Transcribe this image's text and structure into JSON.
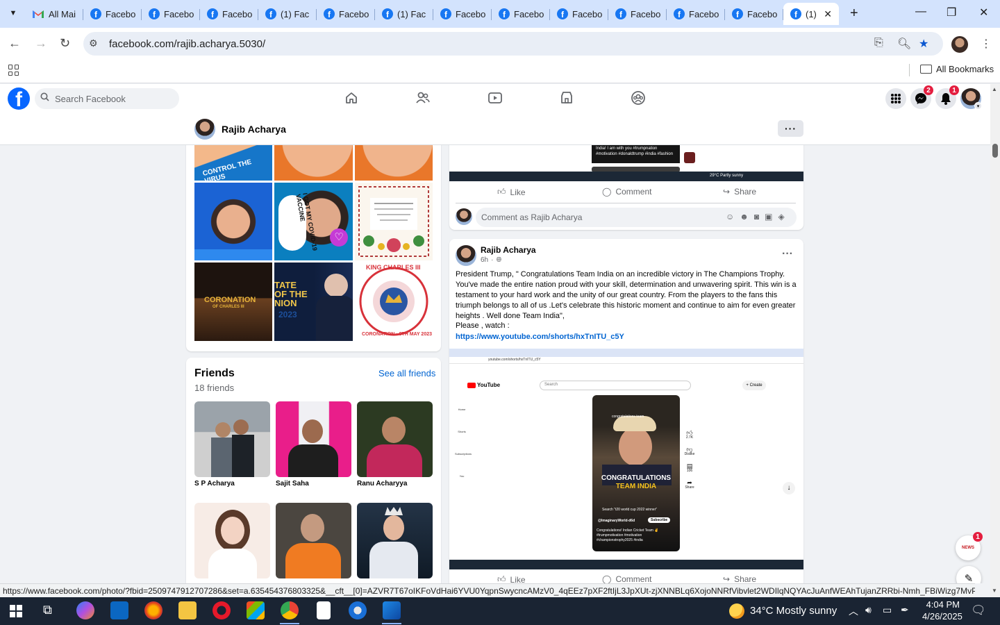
{
  "browser": {
    "tabs": [
      {
        "label": "All Mai",
        "favicon": "gmail-icon"
      },
      {
        "label": "Facebo",
        "favicon": "facebook-icon"
      },
      {
        "label": "Facebo",
        "favicon": "facebook-icon"
      },
      {
        "label": "Facebo",
        "favicon": "facebook-icon"
      },
      {
        "label": "(1) Fac",
        "favicon": "facebook-icon"
      },
      {
        "label": "Facebo",
        "favicon": "facebook-icon"
      },
      {
        "label": "(1) Fac",
        "favicon": "facebook-icon"
      },
      {
        "label": "Facebo",
        "favicon": "facebook-icon"
      },
      {
        "label": "Facebo",
        "favicon": "facebook-icon"
      },
      {
        "label": "Facebo",
        "favicon": "facebook-icon"
      },
      {
        "label": "Facebo",
        "favicon": "facebook-icon"
      },
      {
        "label": "Facebo",
        "favicon": "facebook-icon"
      },
      {
        "label": "Facebo",
        "favicon": "facebook-icon"
      },
      {
        "label": "(1)",
        "favicon": "facebook-icon",
        "active": true
      }
    ],
    "url": "facebook.com/rajib.acharya.5030/",
    "bookmarks_label": "All Bookmarks",
    "status_url": "https://www.facebook.com/photo/?fbid=2509747912707286&set=a.635454376803325&__cft__[0]=AZVR7T67oIKFoVdHai6YVU0YqpnSwycncAMzV0_4qEEz7pXF2ftIjL3JpXUt-zjXNNBLq6XojoNNRfVibvlet2WDIlqNQYAcJuAnfWEAhTujanZRRbi-Nmh_FBiWizg7MvPYAsv..."
  },
  "facebook": {
    "search_placeholder": "Search Facebook",
    "messenger_badge": "2",
    "notifications_badge": "1",
    "brand_color": "#1877f2"
  },
  "profile": {
    "name": "Rajib Acharya",
    "more_label": "···"
  },
  "photos": {
    "captions": {
      "control_virus": "CONTROL THE VIRUS",
      "vaccine": "I GOT MY COVID-19 VACCINE",
      "coronation": "CORONATION",
      "coronation_sub": "OF CHARLES III",
      "state_of_union": "TATE OF THE NION",
      "state_year": "2023",
      "king_charles": "KING CHARLES III",
      "coronation_date": "CORONATION · 6TH MAY 2023"
    }
  },
  "friends": {
    "title": "Friends",
    "count": "18 friends",
    "see_all": "See all friends",
    "list": [
      {
        "name": "S P Acharya"
      },
      {
        "name": "Sajit Saha"
      },
      {
        "name": "Ranu Acharyya"
      },
      {
        "name": ""
      },
      {
        "name": ""
      },
      {
        "name": ""
      }
    ]
  },
  "post_prev": {
    "caption": "India! I am with you #trumpnation #motivation #donaldtrump #india #fashion",
    "like": "Like",
    "comment": "Comment",
    "share": "Share",
    "comment_placeholder": "Comment as Rajib Acharya",
    "taskbar_weather": "29°C Partly sunny"
  },
  "post": {
    "author": "Rajib Acharya",
    "time": "6h",
    "body": "President Trump, \" Congratulations Team India on an incredible  victory in The Champions Trophy. You've made the entire nation proud with your skill, determination and unwavering spirit. This win is a testament to your hard work  and the unity of our great country. From the players to the fans this triumph belongs to  all of us .Let's celebrate this historic  moment and continue to aim for even greater heights . Well done Team India\",",
    "watch": "Please , watch  :",
    "link": "https://www.youtube.com/shorts/hxTnITU_c5Y",
    "like": "Like",
    "comment": "Comment",
    "share": "Share",
    "embed": {
      "yt_url": "youtube.com/shorts/hxTnITU_c5Y",
      "yt_logo": "YouTube",
      "yt_search": "Search",
      "yt_create": "+ Create",
      "video_tag": "congratulations team",
      "headline1": "CONGRATULATIONS",
      "headline2": "TEAM INDIA",
      "search_hint": "Search \"t20 world cup 2022 winner\"",
      "channel": "@ImaginaryWorld-d6d",
      "subscribe": "Subscribe",
      "desc": "Congratulations! Indian Cricket Team ✌️ #trumpmotivation #motivation #championstrophy2025 #india",
      "likes": "2.7K",
      "dislike": "Dislike",
      "comments": "106",
      "share": "Share",
      "side_home": "Home",
      "side_shorts": "Shorts",
      "side_subs": "Subscriptions",
      "side_you": "You"
    }
  },
  "news_widget": {
    "badge": "1",
    "label": "NEWS"
  },
  "taskbar": {
    "weather": "34°C  Mostly sunny",
    "time": "4:04 PM",
    "date": "4/26/2025"
  }
}
